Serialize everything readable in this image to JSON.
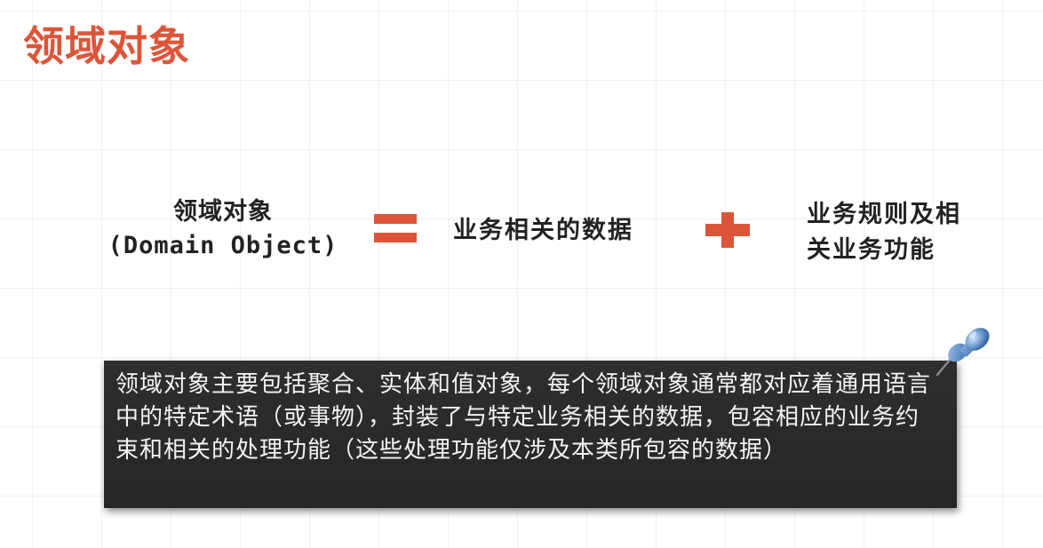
{
  "slide": {
    "title": "领域对象",
    "term_line1": "领域对象",
    "term_line2": "(Domain Object)",
    "operator_equals_icon": "equals-icon",
    "data_text": "业务相关的数据",
    "operator_plus_icon": "plus-icon",
    "rules_line1": "业务规则及相",
    "rules_line2": "关业务功能",
    "note_text": "领域对象主要包括聚合、实体和值对象，每个领域对象通常都对应着通用语言中的特定术语（或事物），封装了与特定业务相关的数据，包容相应的业务约束和相关的处理功能（这些处理功能仅涉及本类所包容的数据）",
    "pin_icon": "pushpin-icon"
  },
  "colors": {
    "accent": "#dd5539",
    "text": "#222222",
    "note_background": "#2a2a2a",
    "note_text": "#f4f4f4",
    "pin": "#5b8fd0"
  }
}
